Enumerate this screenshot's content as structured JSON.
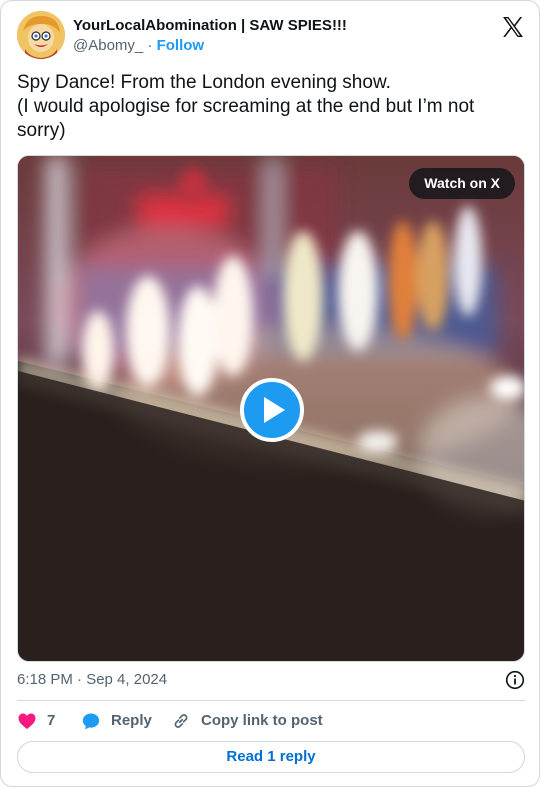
{
  "author": {
    "display_name": "YourLocalAbomination | SAW SPIES!!!",
    "handle": "@Abomy_",
    "separator": "·",
    "follow_label": "Follow"
  },
  "tweet": {
    "text": "Spy Dance! From the London evening show.\n(I would apologise for screaming at the end but I’m not sorry)",
    "timestamp": "6:18 PM · Sep 4, 2024"
  },
  "media": {
    "watch_label": "Watch on X",
    "type": "video"
  },
  "actions": {
    "like_count": "7",
    "reply_label": "Reply",
    "copy_label": "Copy link to post"
  },
  "footer": {
    "read_replies_label": "Read 1 reply"
  },
  "colors": {
    "accent": "#1d9bf0",
    "like": "#f91880",
    "link": "#006fd6",
    "muted": "#536471"
  }
}
